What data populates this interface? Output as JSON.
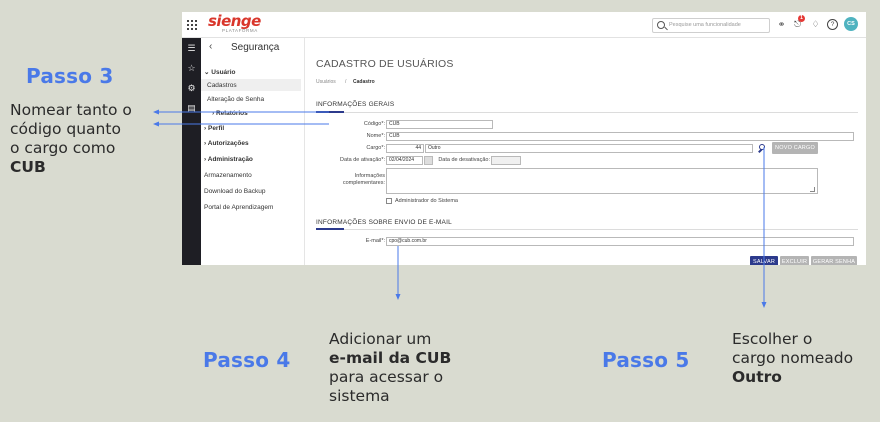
{
  "annotations": {
    "passo3": {
      "title": "Passo 3",
      "line1": "Nomear tanto o",
      "line2": "código quanto",
      "line3": "o cargo como",
      "bold": "CUB"
    },
    "passo4": {
      "title": "Passo 4",
      "line1": "Adicionar um",
      "bold": "e-mail da CUB",
      "line3": "para acessar o",
      "line4": "sistema"
    },
    "passo5": {
      "title": "Passo 5",
      "line1": "Escolher o",
      "line2": "cargo nomeado",
      "bold": "Outro"
    },
    "arrow_color": "#4a79e8"
  },
  "topbar": {
    "logo": "sienge",
    "logo_sub": "PLATAFORMA",
    "search_placeholder": "Pesquise uma funcionalidade",
    "notification_count": "1",
    "avatar": "CS"
  },
  "sidemenu": {
    "title": "Segurança",
    "items": [
      {
        "label": "Usuário"
      },
      {
        "label": "Cadastros"
      },
      {
        "label": "Alteração de Senha"
      },
      {
        "label": "Relatórios"
      },
      {
        "label": "Perfil"
      },
      {
        "label": "Autorizações"
      },
      {
        "label": "Administração"
      },
      {
        "label": "Armazenamento"
      },
      {
        "label": "Download do Backup"
      },
      {
        "label": "Portal de Aprendizagem"
      }
    ]
  },
  "main": {
    "page_title": "CADASTRO DE USUÁRIOS",
    "breadcrumb": [
      "Usuários",
      "Cadastro"
    ],
    "section_general": "INFORMAÇÕES GERAIS",
    "codigo_label": "Código*:",
    "codigo_value": "CUB",
    "nome_label": "Nome*:",
    "nome_value": "CUB",
    "cargo_label": "Cargo*:",
    "cargo_code": "44",
    "cargo_name": "Outro",
    "new_cargo_button": "NOVO CARGO",
    "activation_label": "Data de ativação*:",
    "activation_value": "02/04/2024",
    "deactivation_label": "Data de desativação:",
    "info_label_1": "Informações",
    "info_label_2": "complementares:",
    "admin_checkbox": "Administrador do Sistema",
    "section_email": "INFORMAÇÕES SOBRE ENVIO DE E-MAIL",
    "email_label": "E-mail*:",
    "email_value": "cpo@cub.com.br",
    "buttons": {
      "save": "SALVAR",
      "delete": "EXCLUIR",
      "generate": "GERAR SENHA"
    }
  },
  "colors": {
    "accent": "#2c3a8c",
    "brand": "#d9362b",
    "annotation": "#4a79e8",
    "background": "#d9dbd0"
  }
}
